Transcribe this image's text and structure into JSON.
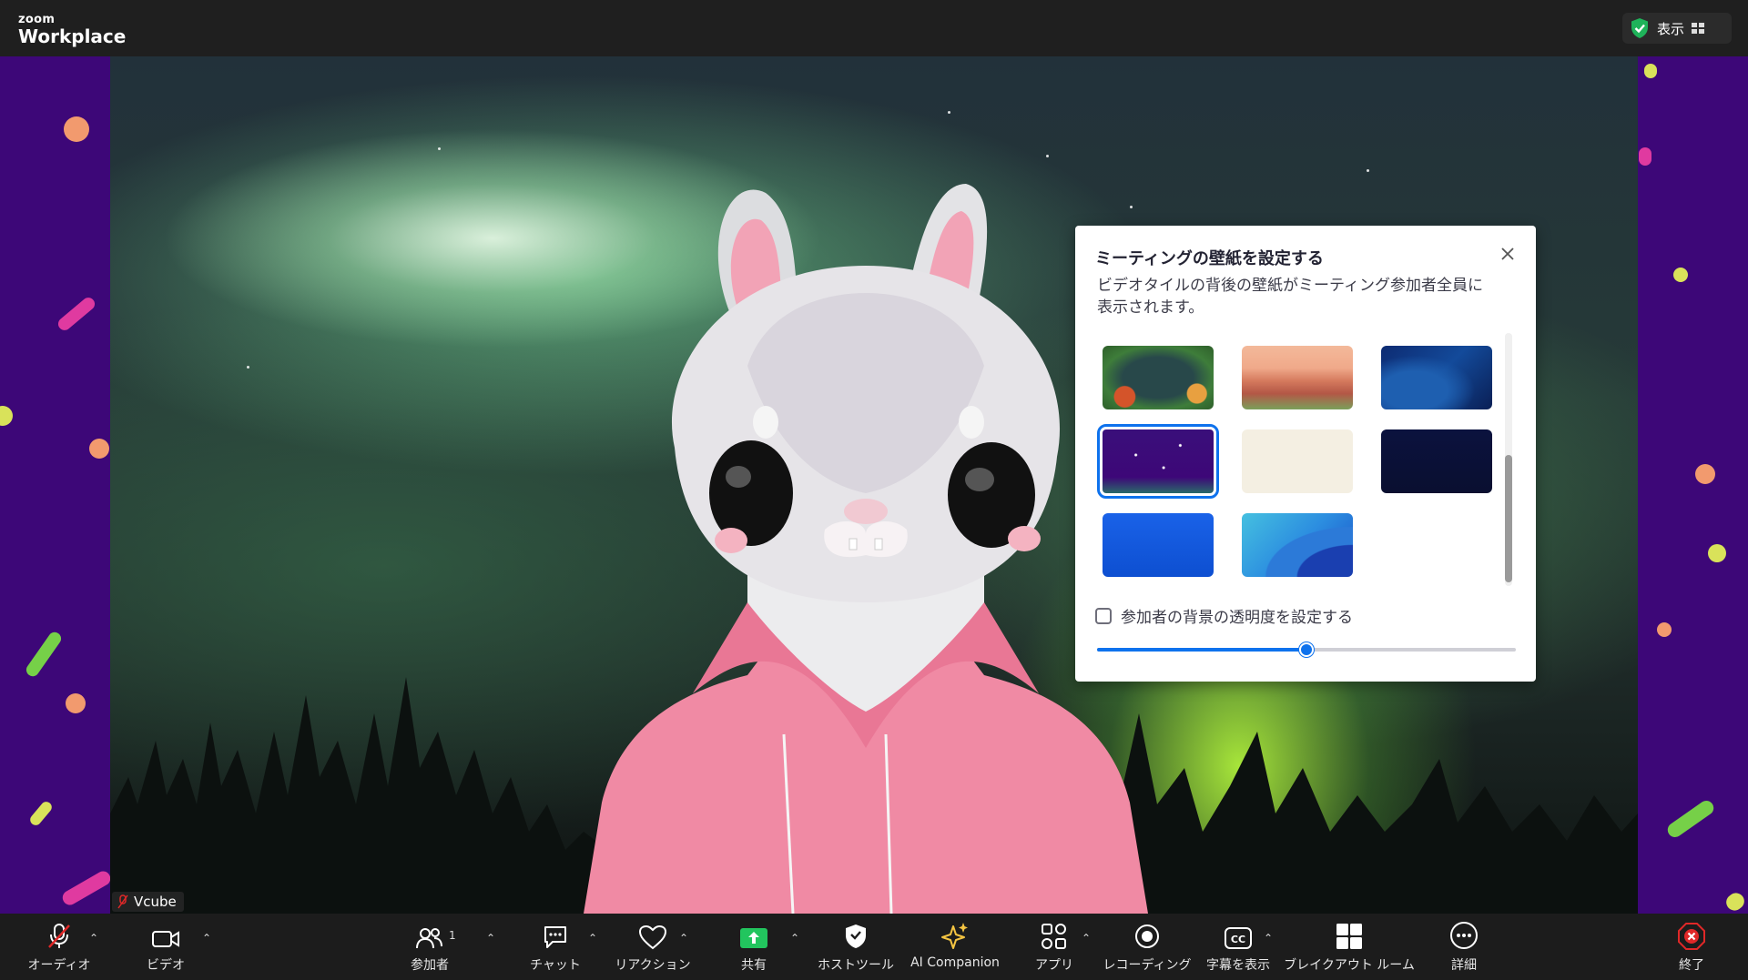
{
  "app": {
    "brand_small": "zoom",
    "brand_name": "Workplace",
    "view_label": "表示"
  },
  "participant": {
    "name": "Vcube"
  },
  "dialog": {
    "title": "ミーティングの壁紙を設定する",
    "description": "ビデオタイルの背後の壁紙がミーティング参加者全員に表示されます。",
    "checkbox_label": "参加者の背景の透明度を設定する",
    "checkbox_checked": false,
    "transparency_fraction": 0.5,
    "selected_wallpaper_index": 3,
    "wallpapers": [
      "jungle",
      "desert",
      "ocean",
      "purple-night",
      "cream",
      "navy",
      "blue-mesh",
      "blue-waves"
    ]
  },
  "toolbar": {
    "audio": "オーディオ",
    "video": "ビデオ",
    "participants": "参加者",
    "participants_count": "1",
    "chat": "チャット",
    "reactions": "リアクション",
    "share": "共有",
    "host_tools": "ホストツール",
    "ai_companion": "AI Companion",
    "apps": "アプリ",
    "recording": "レコーディング",
    "captions": "字幕を表示",
    "breakout": "ブレイクアウト ルーム",
    "more": "詳細",
    "end": "終了"
  },
  "colors": {
    "accent": "#0e72ed",
    "share_green": "#22c55e",
    "end_red": "#e02828",
    "stage_purple": "#3d0778"
  }
}
